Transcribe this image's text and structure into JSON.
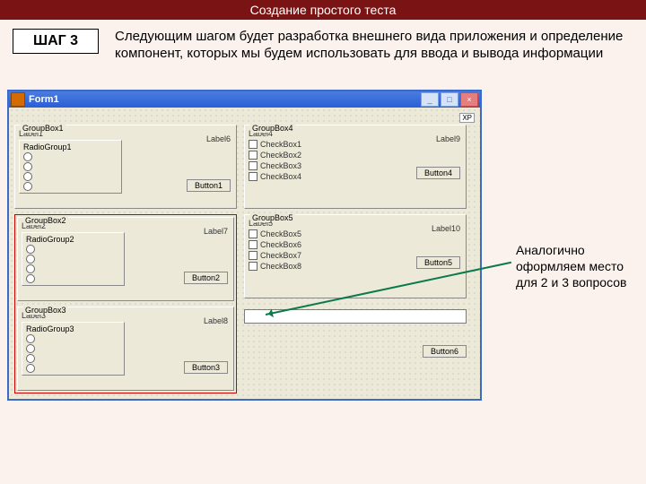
{
  "banner": "Создание простого теста",
  "step": "ШАГ 3",
  "description": "Следующим шагом будет разработка внешнего вида приложения и определение компонент, которых мы будем использовать для ввода и вывода информации",
  "annotation": "Аналогично оформляем место для 2 и 3 вопросов",
  "window": {
    "title": "Form1",
    "xp": "XP"
  },
  "gb1": {
    "cap": "GroupBox1",
    "label": "Label1",
    "rg": "RadioGroup1",
    "side": "Label6",
    "btn": "Button1"
  },
  "gb2": {
    "cap": "GroupBox2",
    "label": "Label2",
    "rg": "RadioGroup2",
    "side": "Label7",
    "btn": "Button2"
  },
  "gb3": {
    "cap": "GroupBox3",
    "label": "Label3",
    "rg": "RadioGroup3",
    "side": "Label8",
    "btn": "Button3"
  },
  "gb4": {
    "cap": "GroupBox4",
    "label": "Label4",
    "c": [
      "CheckBox1",
      "CheckBox2",
      "CheckBox3",
      "CheckBox4"
    ],
    "side": "Label9",
    "btn": "Button4"
  },
  "gb5": {
    "cap": "GroupBox5",
    "label": "Label5",
    "c": [
      "CheckBox5",
      "CheckBox6",
      "CheckBox7",
      "CheckBox8"
    ],
    "side": "Label10",
    "btn": "Button5"
  },
  "bottomBtn": "Button6"
}
